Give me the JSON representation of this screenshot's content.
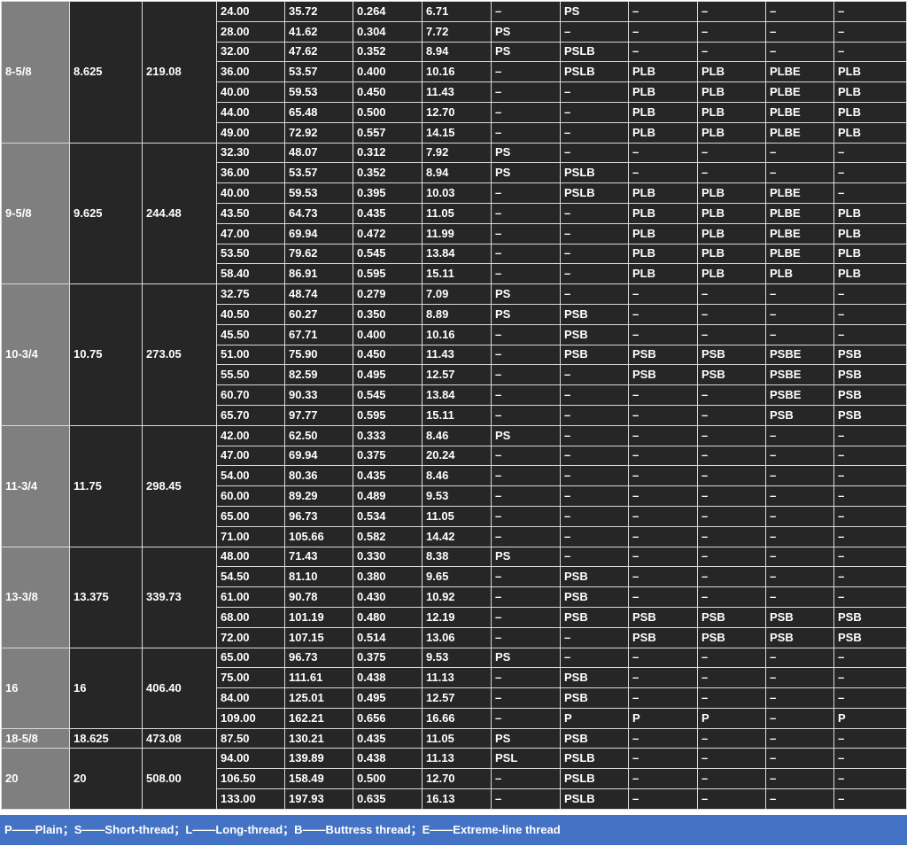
{
  "groups": [
    {
      "size": "8-5/8",
      "od_in": "8.625",
      "od_mm": "219.08",
      "rows": [
        [
          "24.00",
          "35.72",
          "0.264",
          "6.71",
          "–",
          "PS",
          "–",
          "–",
          "–",
          "–"
        ],
        [
          "28.00",
          "41.62",
          "0.304",
          "7.72",
          "PS",
          "–",
          "–",
          "–",
          "–",
          "–"
        ],
        [
          "32.00",
          "47.62",
          "0.352",
          "8.94",
          "PS",
          "PSLB",
          "–",
          "–",
          "–",
          "–"
        ],
        [
          "36.00",
          "53.57",
          "0.400",
          "10.16",
          "–",
          "PSLB",
          "PLB",
          "PLB",
          "PLBE",
          "PLB"
        ],
        [
          "40.00",
          "59.53",
          "0.450",
          "11.43",
          "–",
          "–",
          "PLB",
          "PLB",
          "PLBE",
          "PLB"
        ],
        [
          "44.00",
          "65.48",
          "0.500",
          "12.70",
          "–",
          "–",
          "PLB",
          "PLB",
          "PLBE",
          "PLB"
        ],
        [
          "49.00",
          "72.92",
          "0.557",
          "14.15",
          "–",
          "–",
          "PLB",
          "PLB",
          "PLBE",
          "PLB"
        ]
      ]
    },
    {
      "size": "9-5/8",
      "od_in": "9.625",
      "od_mm": "244.48",
      "rows": [
        [
          "32.30",
          "48.07",
          "0.312",
          "7.92",
          "PS",
          "–",
          "–",
          "–",
          "–",
          "–"
        ],
        [
          "36.00",
          "53.57",
          "0.352",
          "8.94",
          "PS",
          "PSLB",
          "–",
          "–",
          "–",
          "–"
        ],
        [
          "40.00",
          "59.53",
          "0.395",
          "10.03",
          "–",
          "PSLB",
          "PLB",
          "PLB",
          "PLBE",
          "–"
        ],
        [
          "43.50",
          "64.73",
          "0.435",
          "11.05",
          "–",
          "–",
          "PLB",
          "PLB",
          "PLBE",
          "PLB"
        ],
        [
          "47.00",
          "69.94",
          "0.472",
          "11.99",
          "–",
          "–",
          "PLB",
          "PLB",
          "PLBE",
          "PLB"
        ],
        [
          "53.50",
          "79.62",
          "0.545",
          "13.84",
          "–",
          "–",
          "PLB",
          "PLB",
          "PLBE",
          "PLB"
        ],
        [
          "58.40",
          "86.91",
          "0.595",
          "15.11",
          "–",
          "–",
          "PLB",
          "PLB",
          "PLB",
          "PLB"
        ]
      ]
    },
    {
      "size": "10-3/4",
      "od_in": "10.75",
      "od_mm": "273.05",
      "rows": [
        [
          "32.75",
          "48.74",
          "0.279",
          "7.09",
          "PS",
          "–",
          "–",
          "–",
          "–",
          "–"
        ],
        [
          "40.50",
          "60.27",
          "0.350",
          "8.89",
          "PS",
          "PSB",
          "–",
          "–",
          "–",
          "–"
        ],
        [
          "45.50",
          "67.71",
          "0.400",
          "10.16",
          "–",
          "PSB",
          "–",
          "–",
          "–",
          "–"
        ],
        [
          "51.00",
          "75.90",
          "0.450",
          "11.43",
          "–",
          "PSB",
          "PSB",
          "PSB",
          "PSBE",
          "PSB"
        ],
        [
          "55.50",
          "82.59",
          "0.495",
          "12.57",
          "–",
          "–",
          "PSB",
          "PSB",
          "PSBE",
          "PSB"
        ],
        [
          "60.70",
          "90.33",
          "0.545",
          "13.84",
          "–",
          "–",
          "–",
          "–",
          "PSBE",
          "PSB"
        ],
        [
          "65.70",
          "97.77",
          "0.595",
          "15.11",
          "–",
          "–",
          "–",
          "–",
          "PSB",
          "PSB"
        ]
      ]
    },
    {
      "size": "11-3/4",
      "od_in": "11.75",
      "od_mm": "298.45",
      "rows": [
        [
          "42.00",
          "62.50",
          "0.333",
          "8.46",
          "PS",
          "–",
          "–",
          "–",
          "–",
          "–"
        ],
        [
          "47.00",
          "69.94",
          "0.375",
          "20.24",
          "–",
          "–",
          "–",
          "–",
          "–",
          "–"
        ],
        [
          "54.00",
          "80.36",
          "0.435",
          "8.46",
          "–",
          "–",
          "–",
          "–",
          "–",
          "–"
        ],
        [
          "60.00",
          "89.29",
          "0.489",
          "9.53",
          "–",
          "–",
          "–",
          "–",
          "–",
          "–"
        ],
        [
          "65.00",
          "96.73",
          "0.534",
          "11.05",
          "–",
          "–",
          "–",
          "–",
          "–",
          "–"
        ],
        [
          "71.00",
          "105.66",
          "0.582",
          "14.42",
          "–",
          "–",
          "–",
          "–",
          "–",
          "–"
        ]
      ]
    },
    {
      "size": "13-3/8",
      "od_in": "13.375",
      "od_mm": "339.73",
      "rows": [
        [
          "48.00",
          "71.43",
          "0.330",
          "8.38",
          "PS",
          "–",
          "–",
          "–",
          "–",
          "–"
        ],
        [
          "54.50",
          "81.10",
          "0.380",
          "9.65",
          "–",
          "PSB",
          "–",
          "–",
          "–",
          "–"
        ],
        [
          "61.00",
          "90.78",
          "0.430",
          "10.92",
          "–",
          "PSB",
          "–",
          "–",
          "–",
          "–"
        ],
        [
          "68.00",
          "101.19",
          "0.480",
          "12.19",
          "–",
          "PSB",
          "PSB",
          "PSB",
          "PSB",
          "PSB"
        ],
        [
          "72.00",
          "107.15",
          "0.514",
          "13.06",
          "–",
          "–",
          "PSB",
          "PSB",
          "PSB",
          "PSB"
        ]
      ]
    },
    {
      "size": "16",
      "od_in": "16",
      "od_mm": "406.40",
      "rows": [
        [
          "65.00",
          "96.73",
          "0.375",
          "9.53",
          "PS",
          "–",
          "–",
          "–",
          "–",
          "–"
        ],
        [
          "75.00",
          "111.61",
          "0.438",
          "11.13",
          "–",
          "PSB",
          "–",
          "–",
          "–",
          "–"
        ],
        [
          "84.00",
          "125.01",
          "0.495",
          "12.57",
          "–",
          "PSB",
          "–",
          "–",
          "–",
          "–"
        ],
        [
          "109.00",
          "162.21",
          "0.656",
          "16.66",
          "–",
          "P",
          "P",
          "P",
          "–",
          "P"
        ]
      ]
    },
    {
      "size": "18-5/8",
      "od_in": "18.625",
      "od_mm": "473.08",
      "rows": [
        [
          "87.50",
          "130.21",
          "0.435",
          "11.05",
          "PS",
          "PSB",
          "–",
          "–",
          "–",
          "–"
        ]
      ]
    },
    {
      "size": "20",
      "od_in": "20",
      "od_mm": "508.00",
      "rows": [
        [
          "94.00",
          "139.89",
          "0.438",
          "11.13",
          "PSL",
          "PSLB",
          "–",
          "–",
          "–",
          "–"
        ],
        [
          "106.50",
          "158.49",
          "0.500",
          "12.70",
          "–",
          "PSLB",
          "–",
          "–",
          "–",
          "–"
        ],
        [
          "133.00",
          "197.93",
          "0.635",
          "16.13",
          "–",
          "PSLB",
          "–",
          "–",
          "–",
          "–"
        ]
      ]
    }
  ],
  "legend": "P——Plain；S——Short-thread；L——Long-thread；B——Buttress thread；E——Extreme-line thread"
}
